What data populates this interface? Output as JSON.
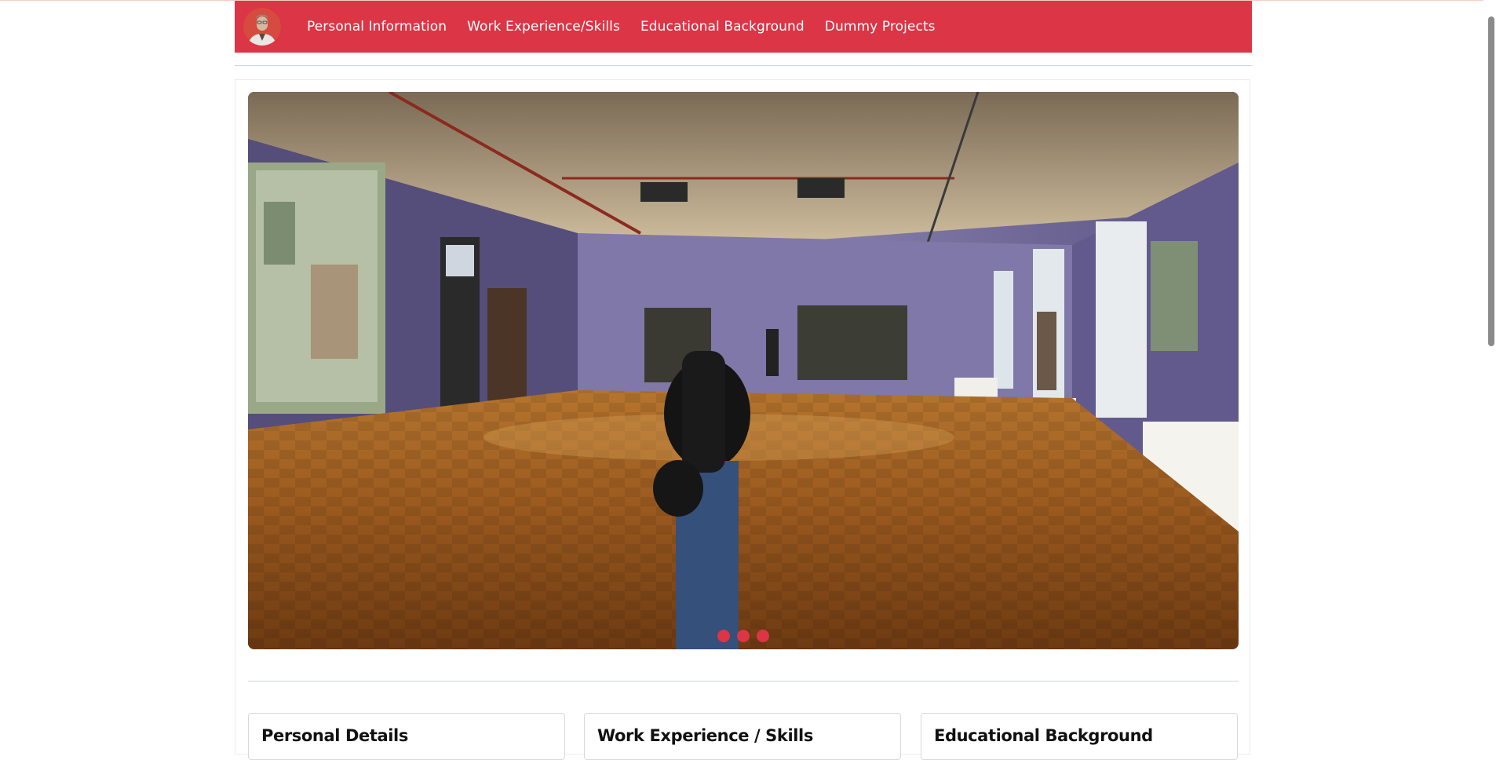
{
  "navbar": {
    "links": [
      "Personal Information",
      "Work Experience/Skills",
      "Educational Background",
      "Dummy Projects"
    ]
  },
  "carousel": {
    "slide_count": 3,
    "active_slide": 1
  },
  "cards": [
    {
      "title": "Personal Details"
    },
    {
      "title": "Work Experience / Skills"
    },
    {
      "title": "Educational Background"
    }
  ],
  "colors": {
    "brand": "#dc3545",
    "nav_text": "#ffffff"
  }
}
